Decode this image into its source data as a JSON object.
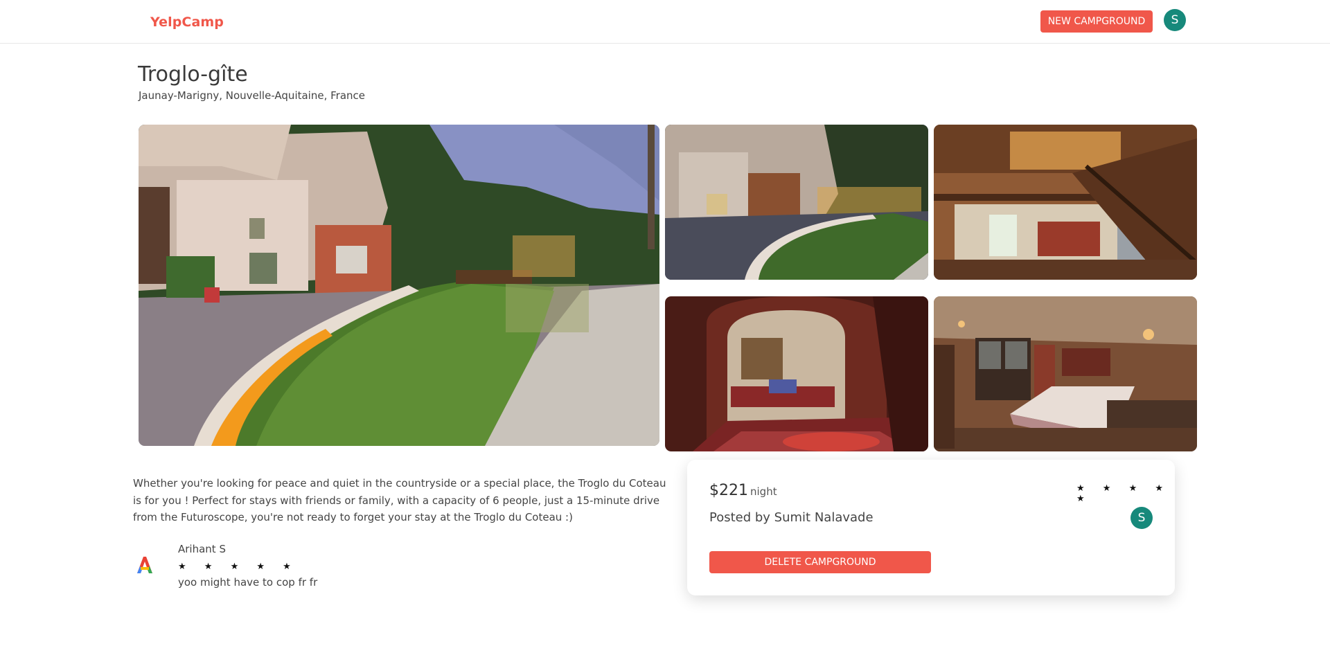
{
  "header": {
    "brand": "YelpCamp",
    "new_campground_label": "NEW CAMPGROUND",
    "avatar_initial": "S"
  },
  "campground": {
    "title": "Troglo-gîte",
    "location": "Jaunay-Marigny, Nouvelle-Aquitaine, France",
    "description": "Whether you're looking for peace and quiet in the countryside or a special place, the Troglo du Coteau is for you ! Perfect for stays with friends or family, with a capacity of 6 people, just a 15-minute drive from the Futuroscope, you're not ready to forget your stay at the Troglo du Coteau :)"
  },
  "review": {
    "author": "Arihant S",
    "stars": "★ ★ ★ ★ ★",
    "text": "yoo might have to cop fr fr"
  },
  "card": {
    "price": "$221",
    "price_unit": "night",
    "stars": "★ ★ ★ ★ ★",
    "posted_by": "Posted by Sumit Nalavade",
    "avatar_initial": "S",
    "delete_label": "DELETE CAMPGROUND"
  },
  "colors": {
    "accent": "#f0574a",
    "avatar": "#17897b"
  }
}
